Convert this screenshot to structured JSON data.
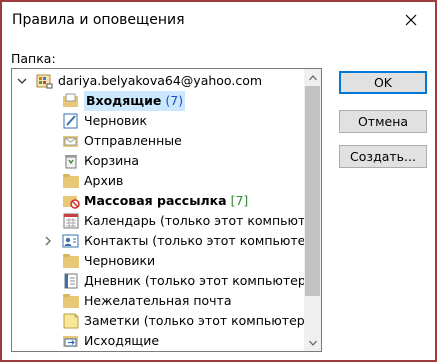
{
  "window": {
    "title": "Правила и оповещения",
    "close_glyph": "✕"
  },
  "folder_label": "Папка:",
  "tree": {
    "account": "dariya.belyakova64@yahoo.com",
    "items": [
      {
        "label": "Входящие",
        "count": "(7)",
        "icon": "inbox-icon",
        "bold": true,
        "selected": true
      },
      {
        "label": "Черновик",
        "icon": "drafts-icon"
      },
      {
        "label": "Отправленные",
        "icon": "sent-icon"
      },
      {
        "label": "Корзина",
        "icon": "trash-icon"
      },
      {
        "label": "Архив",
        "icon": "folder-icon"
      },
      {
        "label": "Массовая рассылка",
        "count": "[7]",
        "icon": "junk-folder-icon",
        "bold": true
      },
      {
        "label": "Календарь (только этот компьютер)",
        "icon": "calendar-icon"
      },
      {
        "label": "Контакты (только этот компьютер)",
        "icon": "contacts-icon",
        "expandable": true
      },
      {
        "label": "Черновики",
        "icon": "folder-icon"
      },
      {
        "label": "Дневник (только этот компьютер)",
        "icon": "journal-icon"
      },
      {
        "label": "Нежелательная почта",
        "icon": "folder-icon"
      },
      {
        "label": "Заметки (только этот компьютер)",
        "icon": "notes-icon"
      },
      {
        "label": "Исходящие",
        "icon": "outbox-icon"
      }
    ]
  },
  "buttons": {
    "ok": "OK",
    "cancel": "Отмена",
    "create": "Создать..."
  },
  "colors": {
    "selection": "#cce8ff",
    "count_blue": "#1a4fd0",
    "count_green": "#2e8b2e",
    "folder": "#e8c777",
    "border": "#9d3c3c"
  }
}
